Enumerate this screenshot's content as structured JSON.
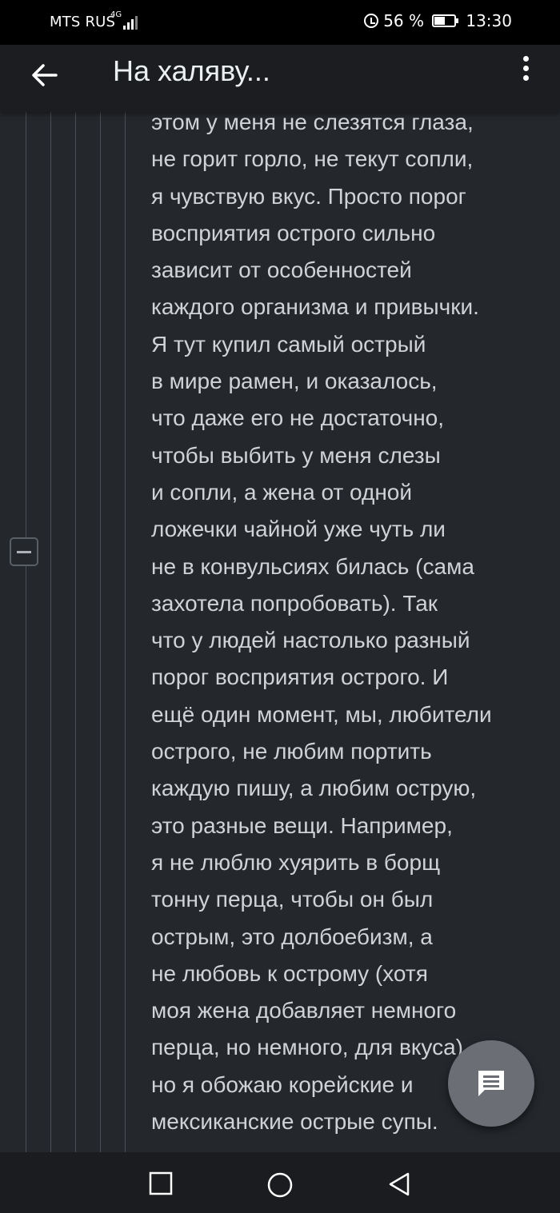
{
  "status_bar": {
    "carrier": "MTS RUS",
    "network": "4G",
    "battery_percent": "56 %",
    "time": "13:30"
  },
  "app_bar": {
    "title": "На халяву..."
  },
  "comment": {
    "text": "этом у меня не слезятся глаза,\nне горит горло, не текут сопли,\nя чувствую вкус. Просто порог\nвосприятия острого сильно\nзависит от особенностей\nкаждого организма и привычки.\nЯ тут купил самый острый\nв мире рамен, и оказалось,\nчто даже его не достаточно,\nчтобы выбить у меня слезы\nи сопли, а жена от одной\nложечки чайной уже чуть ли\nне в конвульсиях билась (сама\nзахотела попробовать). Так\nчто у людей настолько разный\nпорог восприятия острого. И\nещё один момент, мы, любители\nострого, не любим портить\nкаждую пишу, а любим острую,\nэто разные вещи. Например,\nя не люблю хуярить в борщ\nтонну перца, чтобы он был\nострым, это долбоебизм, а\nне любовь к острому (хотя\nмоя жена добавляет немного\nперца, но немного, для вкуса),\nно я обожаю корейские и\nмексиканские острые супы."
  },
  "colors": {
    "background": "#24272c",
    "app_bar": "#1b1d21",
    "text": "#d0d2d6",
    "fab": "#6b6f75"
  },
  "icons": {
    "back": "arrow-left-icon",
    "more": "more-vertical-icon",
    "collapse": "minus-icon",
    "fab": "comment-icon",
    "nav": [
      "square-icon",
      "circle-icon",
      "triangle-back-icon"
    ]
  }
}
